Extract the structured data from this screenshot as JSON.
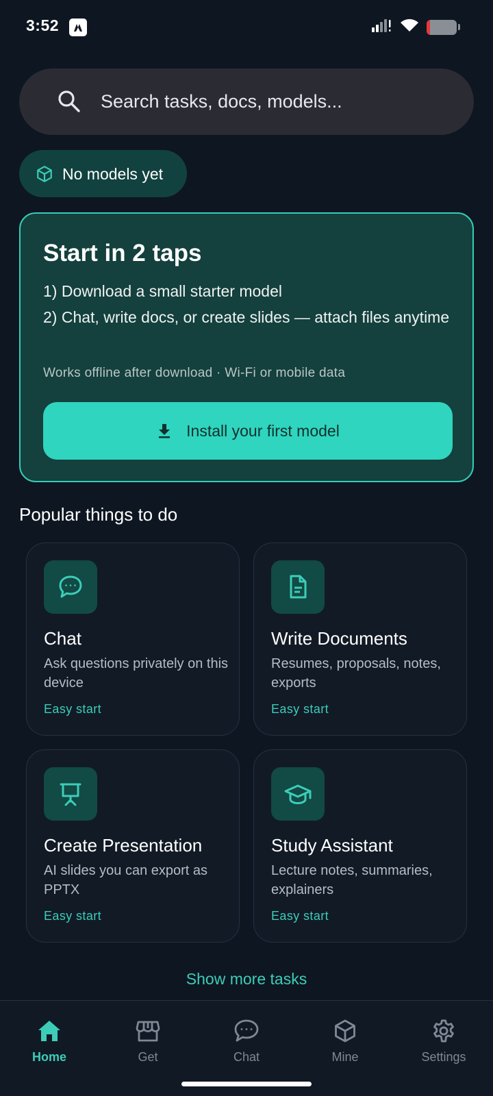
{
  "status_bar": {
    "time": "3:52",
    "battery_level": 0.1
  },
  "search": {
    "placeholder": "Search tasks, docs, models...",
    "icon": "search-icon"
  },
  "status_chip": {
    "label": "No models yet",
    "icon": "cube-icon"
  },
  "hero": {
    "title": "Start in 2 taps",
    "step1": "1) Download a small starter model",
    "step2": "2) Chat, write docs, or create slides — attach files anytime",
    "note": "Works offline after download · Wi-Fi or mobile data",
    "button_label": "Install your first model",
    "button_icon": "download-icon"
  },
  "popular": {
    "title": "Popular things to do",
    "tasks": [
      {
        "title": "Chat",
        "description": "Ask questions privately on this device",
        "tag": "Easy start",
        "icon": "chat-bubble-icon"
      },
      {
        "title": "Write Documents",
        "description": "Resumes, proposals, notes, exports",
        "tag": "Easy start",
        "icon": "document-icon"
      },
      {
        "title": "Create Presentation",
        "description": "AI slides you can export as PPTX",
        "tag": "Easy start",
        "icon": "presentation-icon"
      },
      {
        "title": "Study Assistant",
        "description": "Lecture notes, summaries, explainers",
        "tag": "Easy start",
        "icon": "graduation-cap-icon"
      }
    ],
    "show_more_label": "Show more tasks"
  },
  "nav": {
    "items": [
      {
        "label": "Home",
        "icon": "home-icon",
        "active": true
      },
      {
        "label": "Get",
        "icon": "store-icon",
        "active": false
      },
      {
        "label": "Chat",
        "icon": "chat-bubble-icon",
        "active": false
      },
      {
        "label": "Mine",
        "icon": "cube-icon",
        "active": false
      },
      {
        "label": "Settings",
        "icon": "gear-icon",
        "active": false
      }
    ]
  },
  "colors": {
    "background": "#0e1621",
    "accent": "#2fd5be",
    "card": "#121a26",
    "hero_card": "#14403d",
    "chip": "#11423f"
  }
}
